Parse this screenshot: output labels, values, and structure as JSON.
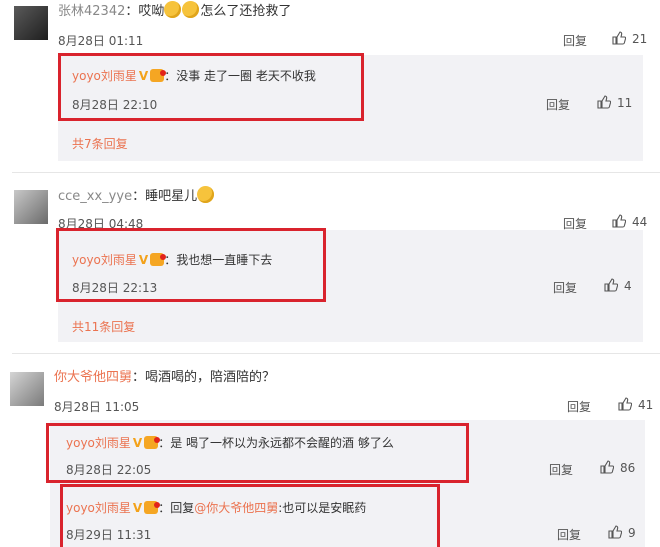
{
  "colors": {
    "accent": "#eb7350",
    "frame": "#d9232d",
    "reply_bg": "#f2f2f5"
  },
  "comments": [
    {
      "user": "张林42342",
      "text_before": "：哎呦",
      "emoji": [
        "cry-face",
        "cry-face"
      ],
      "text_after": "怎么了还抢救了",
      "time": "8月28日 01:11",
      "reply_label": "回复",
      "likes": "21",
      "replies": [
        {
          "user": "yoyo刘雨星",
          "v": "V",
          "text": "：没事 走了一圈 老天不收我",
          "time": "8月28日 22:10",
          "reply_label": "回复",
          "likes": "11"
        }
      ],
      "more": "共7条回复"
    },
    {
      "user": "cce_xx_yye",
      "text_before": "：睡吧星儿",
      "emoji": [
        "sad-face"
      ],
      "text_after": "",
      "time": "8月28日 04:48",
      "reply_label": "回复",
      "likes": "44",
      "replies": [
        {
          "user": "yoyo刘雨星",
          "v": "V",
          "text": "：我也想一直睡下去",
          "time": "8月28日 22:13",
          "reply_label": "回复",
          "likes": "4"
        }
      ],
      "more": "共11条回复"
    },
    {
      "user": "你大爷他四舅",
      "text_before": "：喝酒喝的，陪酒陪的？",
      "emoji": [],
      "text_after": "",
      "time": "8月28日 11:05",
      "reply_label": "回复",
      "likes": "41",
      "replies": [
        {
          "user": "yoyo刘雨星",
          "v": "V",
          "text": "：是 喝了一杯以为永远都不会醒的酒 够了么",
          "time": "8月28日 22:05",
          "reply_label": "回复",
          "likes": "86"
        },
        {
          "user": "yoyo刘雨星",
          "v": "V",
          "text_before": "：回复",
          "mention": "@你大爷他四舅",
          "text": ":也可以是安眠药",
          "time": "8月29日 11:31",
          "reply_label": "回复",
          "likes": "9"
        }
      ]
    }
  ]
}
